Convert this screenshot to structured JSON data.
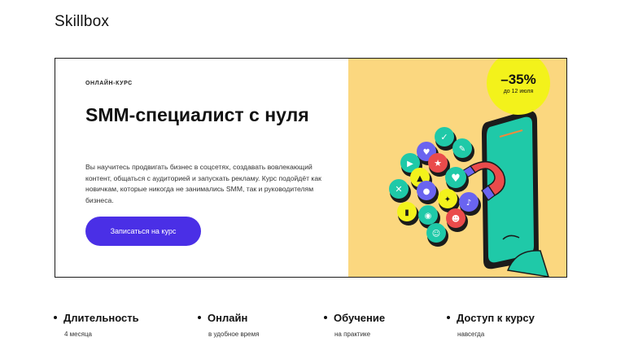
{
  "header": {
    "logo": "Skillbox"
  },
  "hero": {
    "eyebrow": "ОНЛАЙН-КУРС",
    "title": "SMM-специалист с нуля",
    "description": "Вы научитесь продвигать бизнес в соцсетях, создавать вовлекающий контент, общаться с аудиторией и запускать рекламу. Курс подойдёт как новичкам, которые никогда не занимались SMM, так и руководителям бизнеса.",
    "cta_label": "Записаться на курс",
    "badge": {
      "discount": "–35%",
      "until": "до 12 июля"
    }
  },
  "features": [
    {
      "title": "Длительность",
      "subtitle": "4 месяца"
    },
    {
      "title": "Онлайн",
      "subtitle": "в удобное время"
    },
    {
      "title": "Обучение",
      "subtitle": "на практике"
    },
    {
      "title": "Доступ к курсу",
      "subtitle": "навсегда"
    }
  ],
  "colors": {
    "accent": "#4a2fe6",
    "illustration_bg": "#fbd77f",
    "badge": "#f3f21b",
    "phone": "#1fc9a8"
  }
}
